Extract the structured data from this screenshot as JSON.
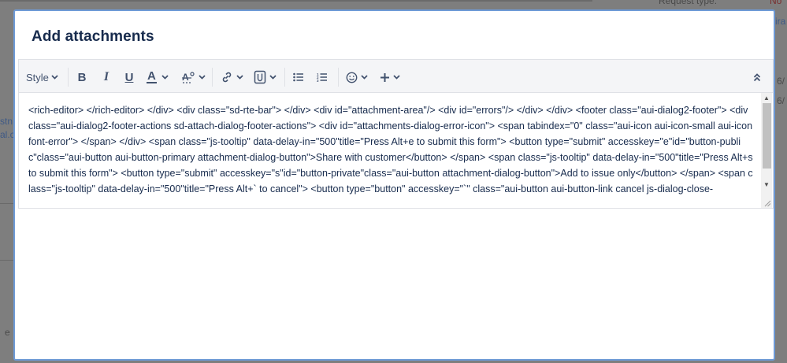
{
  "background": {
    "request_type_label": "Request type:",
    "request_type_value": "No",
    "right_fragment_1": "ira",
    "right_fragment_2": "6/",
    "right_fragment_3": "6/",
    "left_fragment_1": "stn",
    "left_fragment_2": "al.c",
    "left_fragment_3": "e"
  },
  "dialog": {
    "title": "Add attachments"
  },
  "toolbar": {
    "style_label": "Style",
    "bold_label": "B",
    "italic_label": "I",
    "underline_label": "U",
    "text_color_label": "A",
    "icons": {
      "style_dropdown": "chevron-down-icon",
      "text_effects": "text-effects-icon",
      "link": "link-icon",
      "attachment": "attachment-icon",
      "bullet_list": "bullet-list-icon",
      "numbered_list": "numbered-list-icon",
      "emoji": "emoji-icon",
      "insert": "plus-icon",
      "collapse": "double-chevron-up-icon"
    }
  },
  "editor": {
    "content": "<rich-editor> </rich-editor> </div> <div class=\"sd-rte-bar\"> </div> <div id=\"attachment-area\"/> <div id=\"errors\"/> </div> </div> <footer class=\"aui-dialog2-footer\"> <div class=\"aui-dialog2-footer-actions sd-attach-dialog-footer-actions\"> <div id=\"attachments-dialog-error-icon\"> <span tabindex=\"0\" class=\"aui-icon aui-icon-small aui-iconfont-error\"> </span> </div> <span class=\"js-tooltip\" data-delay-in=\"500\"title=\"Press Alt+e to submit this form\"> <button type=\"submit\" accesskey=\"e\"id=\"button-public\"class=\"aui-button aui-button-primary attachment-dialog-button\">Share with customer</button> </span> <span class=\"js-tooltip\" data-delay-in=\"500\"title=\"Press Alt+s to submit this form\"> <button type=\"submit\" accesskey=\"s\"id=\"button-private\"class=\"aui-button attachment-dialog-button\">Add to issue only</button> </span> <span class=\"js-tooltip\" data-delay-in=\"500\"title=\"Press Alt+` to cancel\"> <button type=\"button\" accesskey=\"`\" class=\"aui-button aui-button-link cancel js-dialog-close-"
  },
  "colors": {
    "dialog_border": "#6e9ad6",
    "text_primary": "#172b4d",
    "toolbar_bg": "#f4f5f7",
    "icon_color": "#42526e",
    "overlay": "#7e7e7e"
  }
}
